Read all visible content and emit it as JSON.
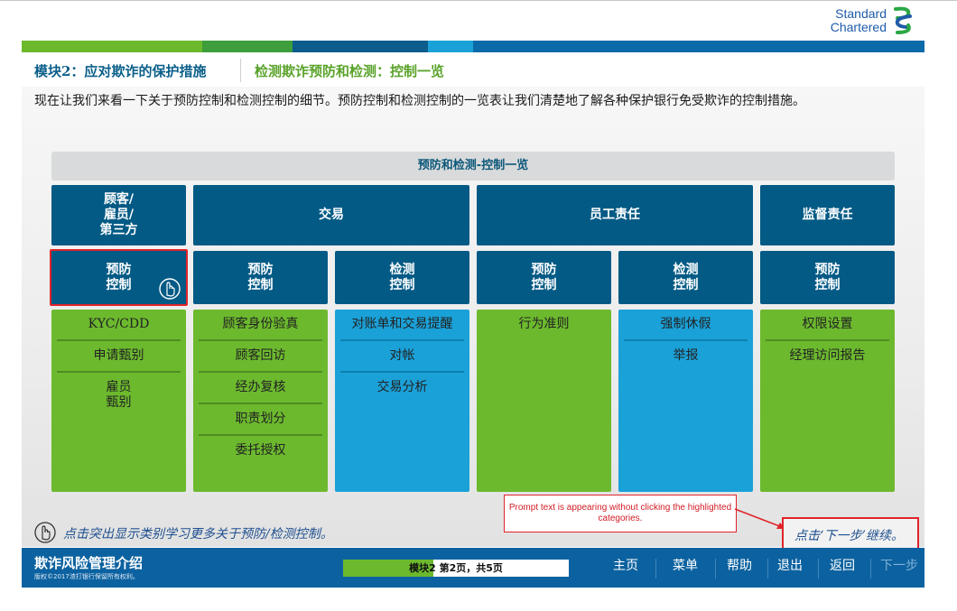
{
  "logo": {
    "line1": "Standard",
    "line2": "Chartered",
    "brand_color": "#1f5ba8",
    "mark_color": "#2aa745"
  },
  "title_bar": {
    "module": "模块2：应对欺诈的保护措施",
    "section": "检测欺诈预防和检测：控制一览"
  },
  "intro_text": "现在让我们来看一下关于预防控制和检测控制的细节。预防控制和检测控制的一览表让我们清楚地了解各种保护银行免受欺诈的控制措施。",
  "table": {
    "header": "预防和检测-控制一览",
    "categories": [
      "顾客/\n雇员/\n第三方",
      "交易",
      "员工责任",
      "监督责任"
    ],
    "subheaders": [
      "预防\n控制",
      "预防\n控制",
      "检测\n控制",
      "预防\n控制",
      "检测\n控制",
      "预防\n控制"
    ],
    "columns": [
      {
        "color": "green",
        "items": [
          "KYC/CDD",
          "申请甄别",
          "雇员\n甄别"
        ]
      },
      {
        "color": "green",
        "items": [
          "顾客身份验真",
          "顾客回访",
          "经办复核",
          "职责划分",
          "委托授权"
        ]
      },
      {
        "color": "blue",
        "items": [
          "对账单和交易提醒",
          "对帐",
          "交易分析"
        ]
      },
      {
        "color": "green",
        "items": [
          "行为准则"
        ]
      },
      {
        "color": "blue",
        "items": [
          "强制休假",
          "举报"
        ]
      },
      {
        "color": "green",
        "items": [
          "权限设置",
          "经理访问报告"
        ]
      }
    ]
  },
  "hint_text": "点击突出显示类别学习更多关于预防/检测控制。",
  "prompt_note": "Prompt text is appearing without clicking the highlighted categories.",
  "next_prompt": "点击‘下一步’继续。",
  "footer": {
    "course_title": "欺诈风险管理介绍",
    "copyright": "版权©2017渣打银行保留所有权利。",
    "progress_text": "模块2 第2页，共5页",
    "progress_fraction": 0.4,
    "nav": [
      "主页",
      "菜单",
      "帮助",
      "退出",
      "返回",
      "下一步"
    ]
  },
  "colors": {
    "dark_blue": "#035a85",
    "green": "#6cb92e",
    "light_blue": "#1aa1d8",
    "alert_red": "#e0242a"
  }
}
